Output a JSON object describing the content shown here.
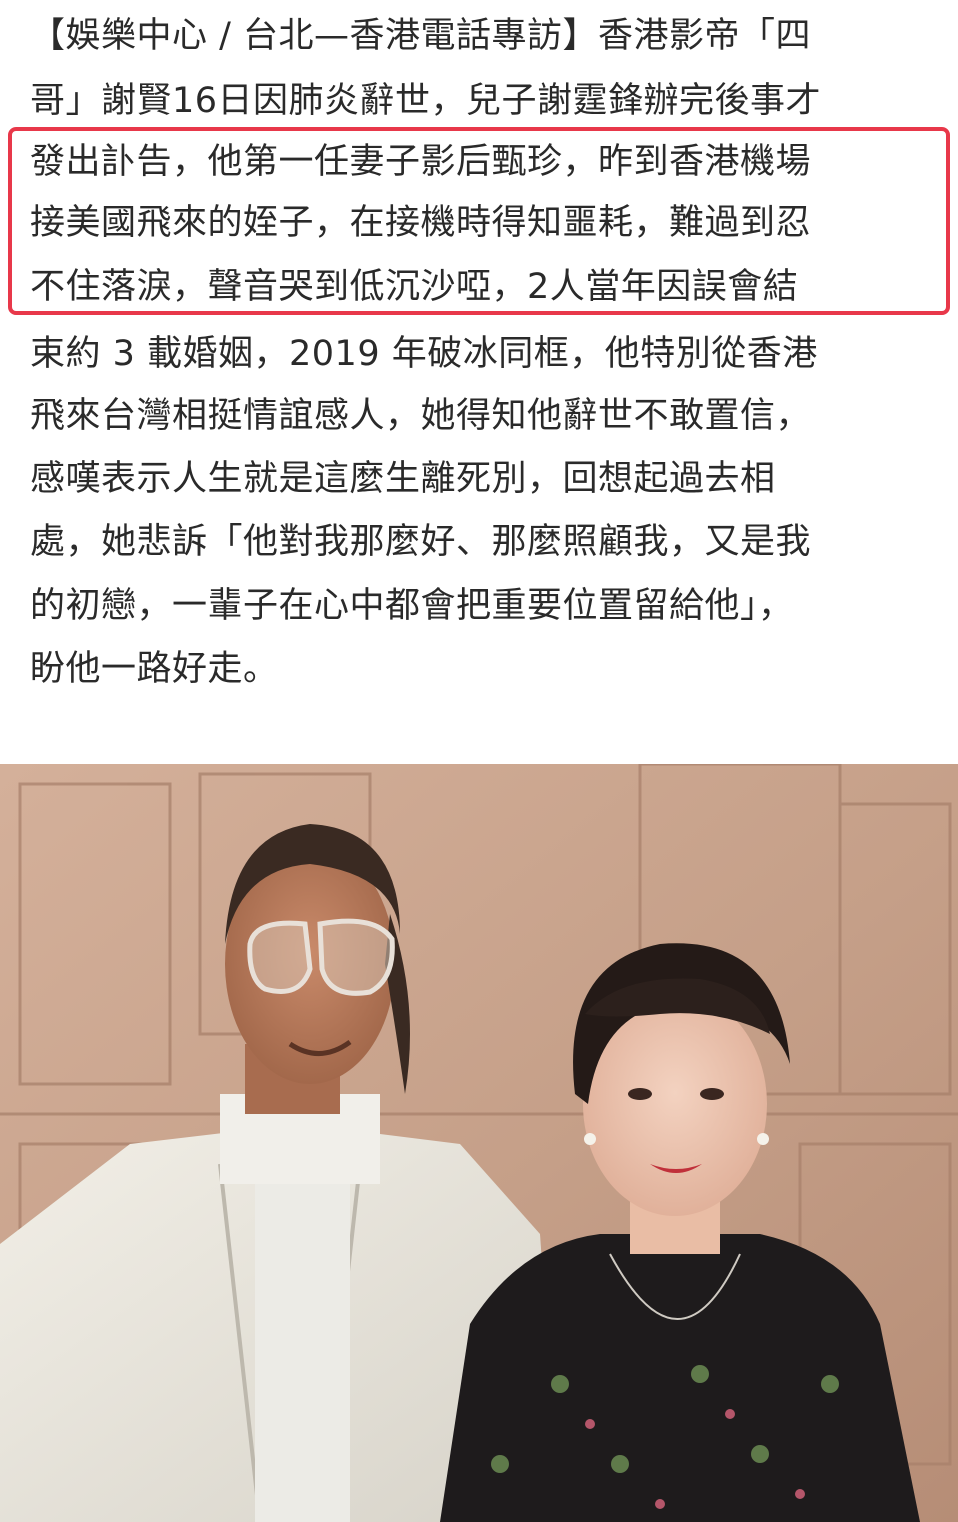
{
  "article": {
    "lines": [
      "【娛樂中心 / 台北—香港電話專訪】香港影帝「四",
      "哥」謝賢16日因肺炎辭世，兒子謝霆鋒辦完後事才",
      "發出訃告，他第一任妻子影后甄珍，昨到香港機場",
      "接美國飛來的姪子，在接機時得知噩耗，難過到忍",
      "不住落淚，聲音哭到低沉沙啞，2人當年因誤會結",
      "束約 3 載婚姻，2019 年破冰同框，他特別從香港",
      "飛來台灣相挺情誼感人，她得知他辭世不敢置信，",
      "感嘆表示人生就是這麼生離死別，回想起過去相",
      "處，她悲訴「他對我那麼好、那麼照顧我，又是我",
      "的初戀，一輩子在心中都會把重要位置留給他」，",
      "盼他一路好走。"
    ],
    "highlight_color": "#e8384a",
    "text_color": "#2a2a2a"
  },
  "photo": {
    "wall_color": "#c9a48c",
    "icon": "photo-icon"
  }
}
